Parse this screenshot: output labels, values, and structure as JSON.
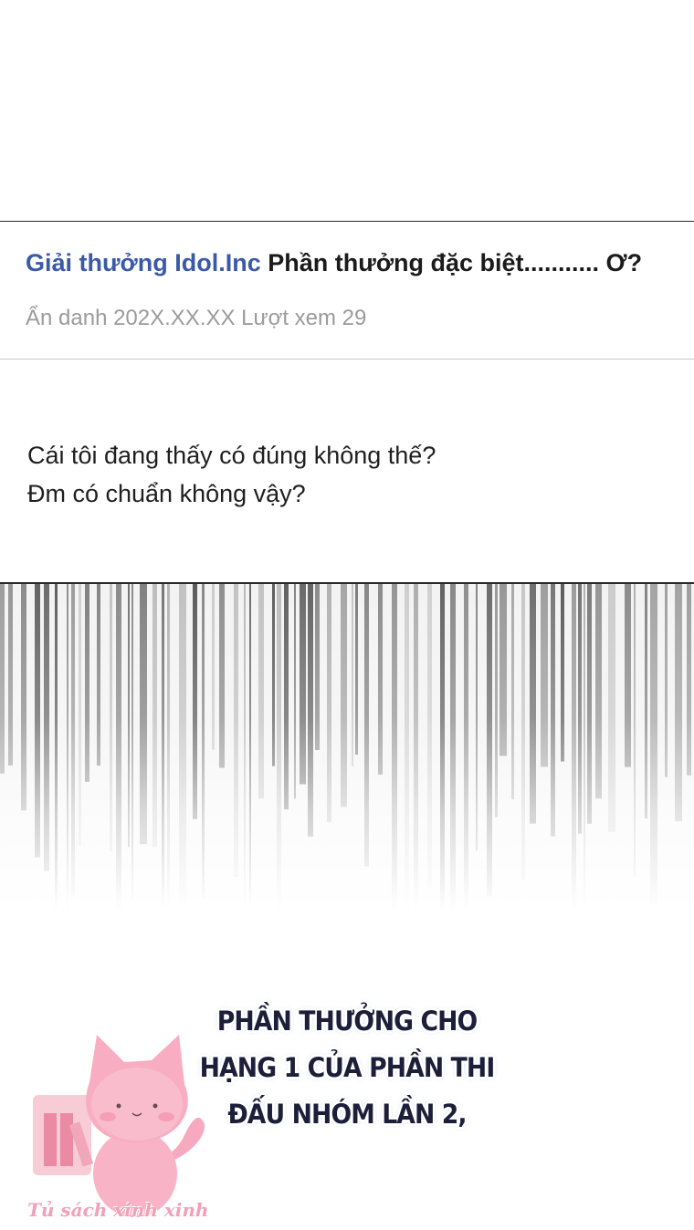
{
  "post": {
    "category": "Giải thưởng Idol.Inc",
    "title": "Phần thưởng đặc biệt........... Ơ?",
    "meta": "Ẩn danh 202X.XX.XX Lượt xem 29",
    "body_lines": [
      "Cái tôi đang thấy có đúng không thế?",
      "Đm có chuẩn không vậy?"
    ]
  },
  "caption": {
    "lines": [
      "PHẦN THƯỞNG CHO",
      "HẠNG 1 CỦA PHẦN THI",
      "ĐẤU NHÓM LẦN 2,"
    ]
  },
  "watermark": {
    "text": "Tủ sách xinh xinh",
    "icon": "pink-cat-icon"
  },
  "colors": {
    "category": "#3a5aa8",
    "meta": "#9b9b9b",
    "caption_outline": "#a9b4e8",
    "watermark": "#f2a0b8"
  }
}
